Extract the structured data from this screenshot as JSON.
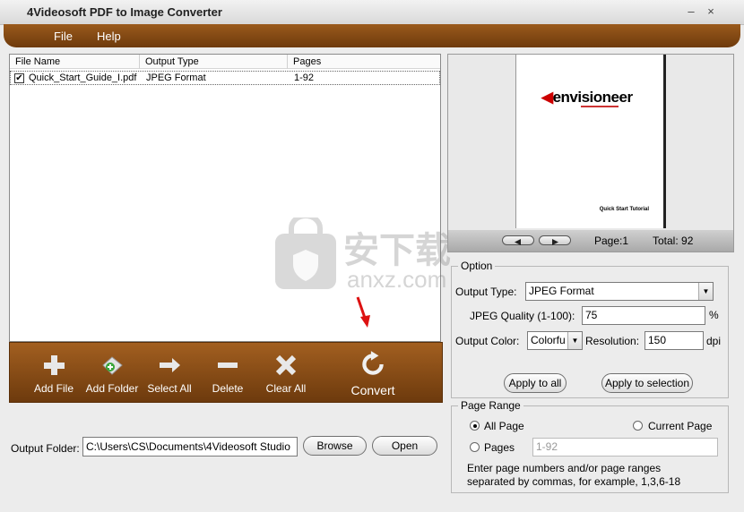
{
  "window": {
    "title": "4Videosoft PDF to Image Converter"
  },
  "menu": {
    "file": "File",
    "help": "Help"
  },
  "file_list": {
    "columns": [
      "File Name",
      "Output Type",
      "Pages"
    ],
    "rows": [
      {
        "checked": true,
        "file_name": "Quick_Start_Guide_I.pdf",
        "output_type": "JPEG Format",
        "pages": "1-92"
      }
    ]
  },
  "toolbar": {
    "add_file": "Add File",
    "add_folder": "Add Folder",
    "select_all": "Select All",
    "delete": "Delete",
    "clear_all": "Clear All",
    "convert": "Convert"
  },
  "output": {
    "label": "Output Folder:",
    "path": "C:\\Users\\CS\\Documents\\4Videosoft Studio",
    "browse": "Browse",
    "open": "Open"
  },
  "preview": {
    "logo_text": "envisioneer",
    "page_caption": "Quick Start Tutorial",
    "page_label": "Page:1",
    "total_label": "Total: 92"
  },
  "option": {
    "legend": "Option",
    "output_type_label": "Output Type:",
    "output_type_value": "JPEG Format",
    "jpeg_quality_label": "JPEG Quality (1-100):",
    "jpeg_quality_value": "75",
    "jpeg_quality_unit": "%",
    "output_color_label": "Output Color:",
    "output_color_value": "Colorfu",
    "resolution_label": "Resolution:",
    "resolution_value": "150",
    "resolution_unit": "dpi",
    "apply_all": "Apply to all",
    "apply_selection": "Apply to selection"
  },
  "page_range": {
    "legend": "Page Range",
    "all_page": "All Page",
    "current_page": "Current Page",
    "pages": "Pages",
    "pages_value": "1-92",
    "hint_line1": "Enter page numbers and/or page ranges",
    "hint_line2": "separated by commas, for example, 1,3,6-18"
  },
  "watermark": {
    "text": "安下载",
    "sub": "anxz.com"
  },
  "colors": {
    "accent": "#8a4a14",
    "brand_red": "#cc0000"
  }
}
